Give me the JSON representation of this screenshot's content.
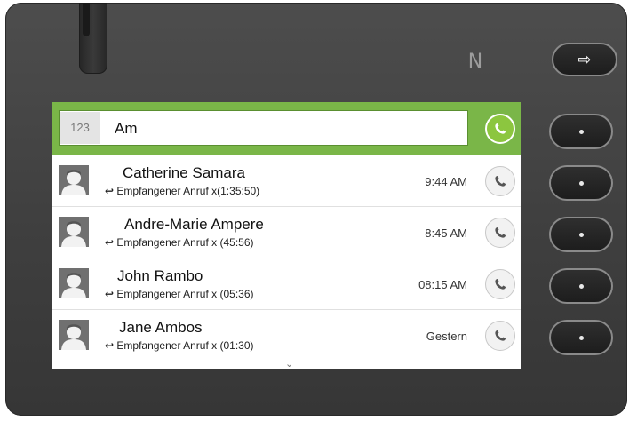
{
  "device": {
    "nfc_label": "N",
    "exit_key_glyph": "⇨"
  },
  "search": {
    "mode": "123",
    "query": "Am"
  },
  "contacts": [
    {
      "name": "Catherine Samara",
      "detail": "Empfangener Anruf x(1:35:50)",
      "time": "9:44 AM"
    },
    {
      "name": "Andre-Marie Ampere",
      "detail": "Empfangener Anruf x (45:56)",
      "time": "8:45 AM"
    },
    {
      "name": "John Rambo",
      "detail": "Empfangener Anruf x (05:36)",
      "time": "08:15 AM"
    },
    {
      "name": "Jane Ambos",
      "detail": "Empfangener Anruf x (01:30)",
      "time": "Gestern"
    }
  ],
  "icons": {
    "received_call": "received-call-icon",
    "phone": "phone-icon",
    "avatar": "avatar-icon",
    "scroll": "chevron-down-icon"
  },
  "colors": {
    "accent_green": "#7ab648",
    "call_green": "#8cc63f",
    "housing": "#444444"
  },
  "scroll_indicator": "⌄"
}
